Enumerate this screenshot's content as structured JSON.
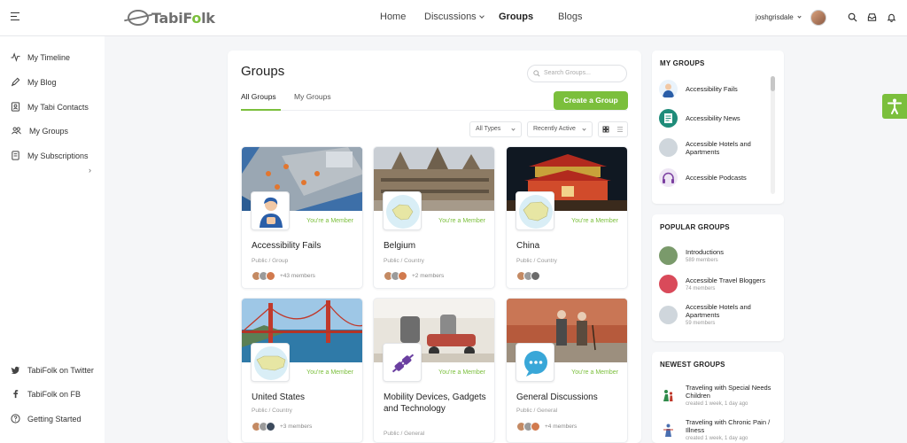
{
  "header": {
    "logo": {
      "prefix": "TabiF",
      "accent": "o",
      "suffix": "lk"
    },
    "nav": [
      {
        "label": "Home",
        "active": false
      },
      {
        "label": "Discussions",
        "active": false,
        "has_dropdown": true
      },
      {
        "label": "Groups",
        "active": true
      },
      {
        "label": "Blogs",
        "active": false
      }
    ],
    "username": "joshgrisdale",
    "icons": [
      "search-icon",
      "inbox-icon",
      "bell-icon"
    ]
  },
  "sidebar": {
    "items": [
      {
        "label": "My Timeline",
        "icon": "activity-icon"
      },
      {
        "label": "My Blog",
        "icon": "pen-icon"
      },
      {
        "label": "My Tabi Contacts",
        "icon": "contacts-icon"
      },
      {
        "label": "My Groups",
        "icon": "groups-icon",
        "has_submenu": true
      },
      {
        "label": "My Subscriptions",
        "icon": "document-icon"
      }
    ],
    "footer": [
      {
        "label": "TabiFolk on Twitter",
        "icon": "twitter-icon"
      },
      {
        "label": "TabiFolk on FB",
        "icon": "facebook-icon"
      },
      {
        "label": "Getting Started",
        "icon": "help-icon"
      }
    ]
  },
  "main": {
    "title": "Groups",
    "search_placeholder": "Search Groups...",
    "tabs": [
      {
        "label": "All Groups",
        "active": true
      },
      {
        "label": "My Groups",
        "active": false
      }
    ],
    "create_label": "Create a Group",
    "filters": {
      "type": "All Types",
      "order": "Recently Active"
    },
    "groups": [
      {
        "name": "Accessibility Fails",
        "status": "You're a Member",
        "meta": "Public / Group",
        "members": "+43 members",
        "cover": "harbor",
        "thumb": "person"
      },
      {
        "name": "Belgium",
        "status": "You're a Member",
        "meta": "Public / Country",
        "members": "+2 members",
        "cover": "belgium",
        "thumb": "map-belgium"
      },
      {
        "name": "China",
        "status": "You're a Member",
        "meta": "Public / Country",
        "members": "",
        "cover": "china",
        "thumb": "map-china"
      },
      {
        "name": "United States",
        "status": "You're a Member",
        "meta": "Public / Country",
        "members": "+3 members",
        "cover": "bridge",
        "thumb": "map-usa"
      },
      {
        "name": "Mobility Devices, Gadgets and Technology",
        "status": "You're a Member",
        "meta": "Public / General",
        "members": "",
        "cover": "scooter",
        "thumb": "plug"
      },
      {
        "name": "General Discussions",
        "status": "You're a Member",
        "meta": "Public / General",
        "members": "+4 members",
        "cover": "elders",
        "thumb": "chat"
      }
    ]
  },
  "widgets": {
    "my_groups": {
      "title": "MY GROUPS",
      "items": [
        {
          "name": "Accessibility Fails"
        },
        {
          "name": "Accessibility News"
        },
        {
          "name": "Accessible Hotels and Apartments"
        },
        {
          "name": "Accessible Podcasts"
        }
      ]
    },
    "popular": {
      "title": "POPULAR GROUPS",
      "items": [
        {
          "name": "Introductions",
          "sub": "589 members"
        },
        {
          "name": "Accessible Travel Bloggers",
          "sub": "74 members"
        },
        {
          "name": "Accessible Hotels and Apartments",
          "sub": "59 members"
        }
      ]
    },
    "newest": {
      "title": "NEWEST GROUPS",
      "items": [
        {
          "name": "Traveling with Special Needs Children",
          "sub": "created 1 week, 1 day ago"
        },
        {
          "name": "Traveling with Chronic Pain / Illness",
          "sub": "created 1 week, 1 day ago"
        }
      ]
    }
  },
  "colors": {
    "accent": "#7bbf3c",
    "text": "#222222",
    "muted": "#999999"
  }
}
